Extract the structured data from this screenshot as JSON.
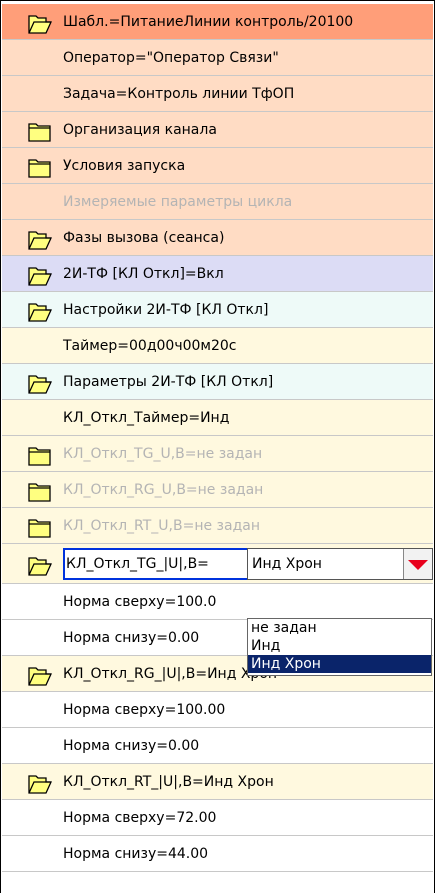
{
  "colors": {
    "accent_edit_border": "#0033dd",
    "dropdown_arrow": "#e8001c",
    "selected_option_bg": "#0a246a",
    "folder_fill": "#ffff80"
  },
  "rows": [
    {
      "label": "Шабл.=ПитаниеЛинии  контроль/20100",
      "icon": "folder-open-icon"
    },
    {
      "label": "Оператор=\"Оператор Связи\"",
      "icon": ""
    },
    {
      "label": "Задача=Контроль линии ТфОП",
      "icon": ""
    },
    {
      "label": "Организация канала",
      "icon": "folder-closed-icon"
    },
    {
      "label": "Условия запуска",
      "icon": "folder-closed-icon"
    },
    {
      "label": "Измеряемые параметры цикла",
      "icon": ""
    },
    {
      "label": "Фазы вызова (сеанса)",
      "icon": "folder-open-icon"
    },
    {
      "label": "2И-ТФ [КЛ Откл]=Вкл",
      "icon": "folder-open-icon"
    },
    {
      "label": "Настройки 2И-ТФ [КЛ Откл]",
      "icon": "folder-open-icon"
    },
    {
      "label": "Таймер=00д00ч00м20с",
      "icon": ""
    },
    {
      "label": "Параметры 2И-ТФ [КЛ Откл]",
      "icon": "folder-open-icon"
    },
    {
      "label": "КЛ_Откл_Таймер=Инд",
      "icon": ""
    },
    {
      "label": "КЛ_Откл_TG_U,B=не задан",
      "icon": "folder-closed-icon"
    },
    {
      "label": "КЛ_Откл_RG_U,B=не задан",
      "icon": "folder-closed-icon"
    },
    {
      "label": "КЛ_Откл_RT_U,B=не задан",
      "icon": "folder-closed-icon"
    },
    {
      "label": "КЛ_Откл_TG_|U|,B=",
      "icon": "folder-open-icon"
    },
    {
      "label": "Норма сверху=100.0",
      "icon": ""
    },
    {
      "label": "Норма снизу=0.00",
      "icon": ""
    },
    {
      "label": "КЛ_Откл_RG_|U|,B=Инд Хрон",
      "icon": "folder-open-icon"
    },
    {
      "label": "Норма сверху=100.00",
      "icon": ""
    },
    {
      "label": "Норма снизу=0.00",
      "icon": ""
    },
    {
      "label": "КЛ_Откл_RT_|U|,B=Инд Хрон",
      "icon": "folder-open-icon"
    },
    {
      "label": "Норма сверху=72.00",
      "icon": ""
    },
    {
      "label": "Норма снизу=44.00",
      "icon": ""
    }
  ],
  "combo": {
    "value": "Инд Хрон",
    "options": [
      "не задан",
      "Инд",
      "Инд Хрон"
    ],
    "selected": "Инд Хрон"
  }
}
